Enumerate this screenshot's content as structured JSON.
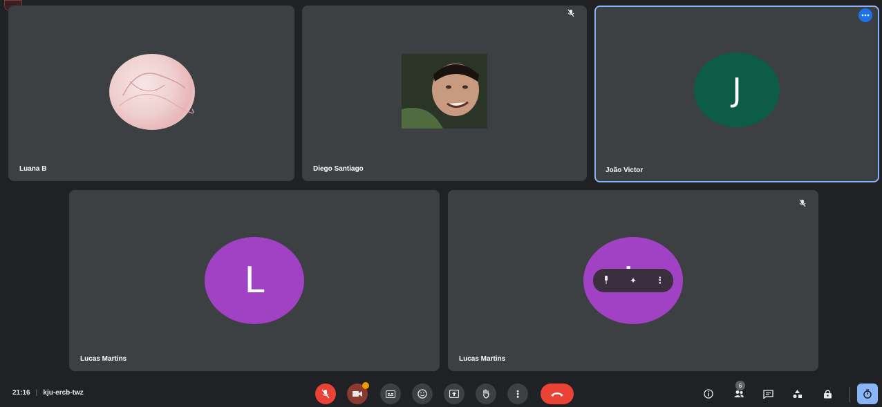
{
  "participants": [
    {
      "name": "Luana B",
      "avatar_letter": "",
      "avatar_kind": "photo-pattern"
    },
    {
      "name": "Diego Santiago",
      "avatar_letter": "",
      "avatar_kind": "photo-person"
    },
    {
      "name": "João Victor",
      "avatar_letter": "J",
      "avatar_color": "#0d5c47",
      "active_speaker": true
    },
    {
      "name": "Lucas Martins",
      "avatar_letter": "L",
      "avatar_color": "#a142c4"
    },
    {
      "name": "Lucas Martins",
      "avatar_letter": "L",
      "avatar_color": "#a142c4"
    }
  ],
  "meeting": {
    "time": "21:16",
    "separator": "|",
    "code": "kju-ercb-twz"
  },
  "controls": {
    "people_count": "6"
  },
  "icons": {
    "mic": "mic-off-icon",
    "camera": "camera-icon",
    "captions": "captions-icon",
    "emoji": "emoji-icon",
    "present": "present-icon",
    "raise_hand": "raise-hand-icon",
    "more": "more-options-icon",
    "end_call": "end-call-icon",
    "info": "info-icon",
    "people": "people-icon",
    "chat": "chat-icon",
    "activities": "activities-icon",
    "host_controls": "host-controls-icon"
  },
  "colors": {
    "background": "#202124",
    "tile": "#3c4043",
    "active_border": "#8ab4f8",
    "end_call": "#ea4335"
  }
}
